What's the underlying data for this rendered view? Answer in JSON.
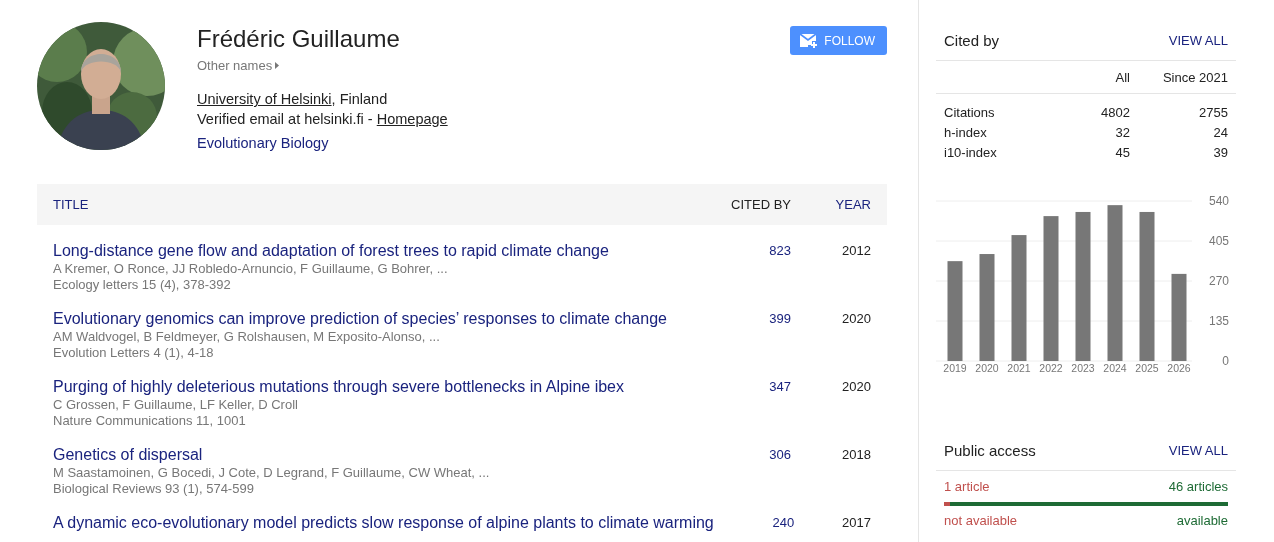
{
  "profile": {
    "name": "Frédéric Guillaume",
    "other_names": "Other names",
    "affiliation": {
      "institution": "University of Helsinki",
      "rest": ", Finland"
    },
    "email": {
      "text": "Verified email at helsinki.fi - ",
      "homepage": "Homepage"
    },
    "interests": [
      "Evolutionary Biology"
    ],
    "follow_button": "FOLLOW"
  },
  "table": {
    "columns": [
      {
        "label": "TITLE",
        "sortable": true
      },
      {
        "label": "CITED BY",
        "sortable": false
      },
      {
        "label": "YEAR",
        "sortable": true
      }
    ],
    "rows": [
      {
        "title": "Long-distance gene flow and adaptation of forest trees to rapid climate change",
        "authors": "A Kremer, O Ronce, JJ Robledo-Arnuncio, F Guillaume, G Bohrer, ...",
        "venue": "Ecology letters 15 (4), 378-392",
        "cited_by": "823",
        "year": "2012"
      },
      {
        "title": "Evolutionary genomics can improve prediction of species’ responses to climate change",
        "authors": "AM Waldvogel, B Feldmeyer, G Rolshausen, M Exposito-Alonso, ...",
        "venue": "Evolution Letters 4 (1), 4-18",
        "cited_by": "399",
        "year": "2020"
      },
      {
        "title": "Purging of highly deleterious mutations through severe bottlenecks in Alpine ibex",
        "authors": "C Grossen, F Guillaume, LF Keller, D Croll",
        "venue": "Nature Communications 11, 1001",
        "cited_by": "347",
        "year": "2020"
      },
      {
        "title": "Genetics of dispersal",
        "authors": "M Saastamoinen, G Bocedi, J Cote, D Legrand, F Guillaume, CW Wheat, ...",
        "venue": "Biological Reviews 93 (1), 574-599",
        "cited_by": "306",
        "year": "2018"
      },
      {
        "title": "A dynamic eco-evolutionary model predicts slow response of alpine plants to climate warming",
        "cited_by": "240",
        "year": "2017"
      }
    ]
  },
  "cited_by": {
    "title": "Cited by",
    "view_all": "VIEW ALL",
    "headers": [
      "All",
      "Since 2021"
    ],
    "rows": [
      {
        "label": "Citations",
        "all": "4802",
        "since": "2755"
      },
      {
        "label": "h-index",
        "all": "32",
        "since": "24"
      },
      {
        "label": "i10-index",
        "all": "45",
        "since": "39"
      }
    ],
    "chart_data": {
      "type": "bar",
      "categories": [
        "2019",
        "2020",
        "2021",
        "2022",
        "2023",
        "2024",
        "2025",
        "2026"
      ],
      "grid": true,
      "series": [
        {
          "color": "#777777",
          "values": [
            337,
            361,
            425,
            489,
            503,
            526,
            503,
            294
          ]
        }
      ],
      "ylim": [
        0,
        540
      ],
      "yticks": [
        0,
        135,
        270,
        405,
        540
      ]
    }
  },
  "public_access": {
    "title": "Public access",
    "view_all": "VIEW ALL",
    "unavailable_count": "1 article",
    "available_count": "46 articles",
    "unavailable_label": "not available",
    "available_label": "available",
    "level": 0.979
  }
}
